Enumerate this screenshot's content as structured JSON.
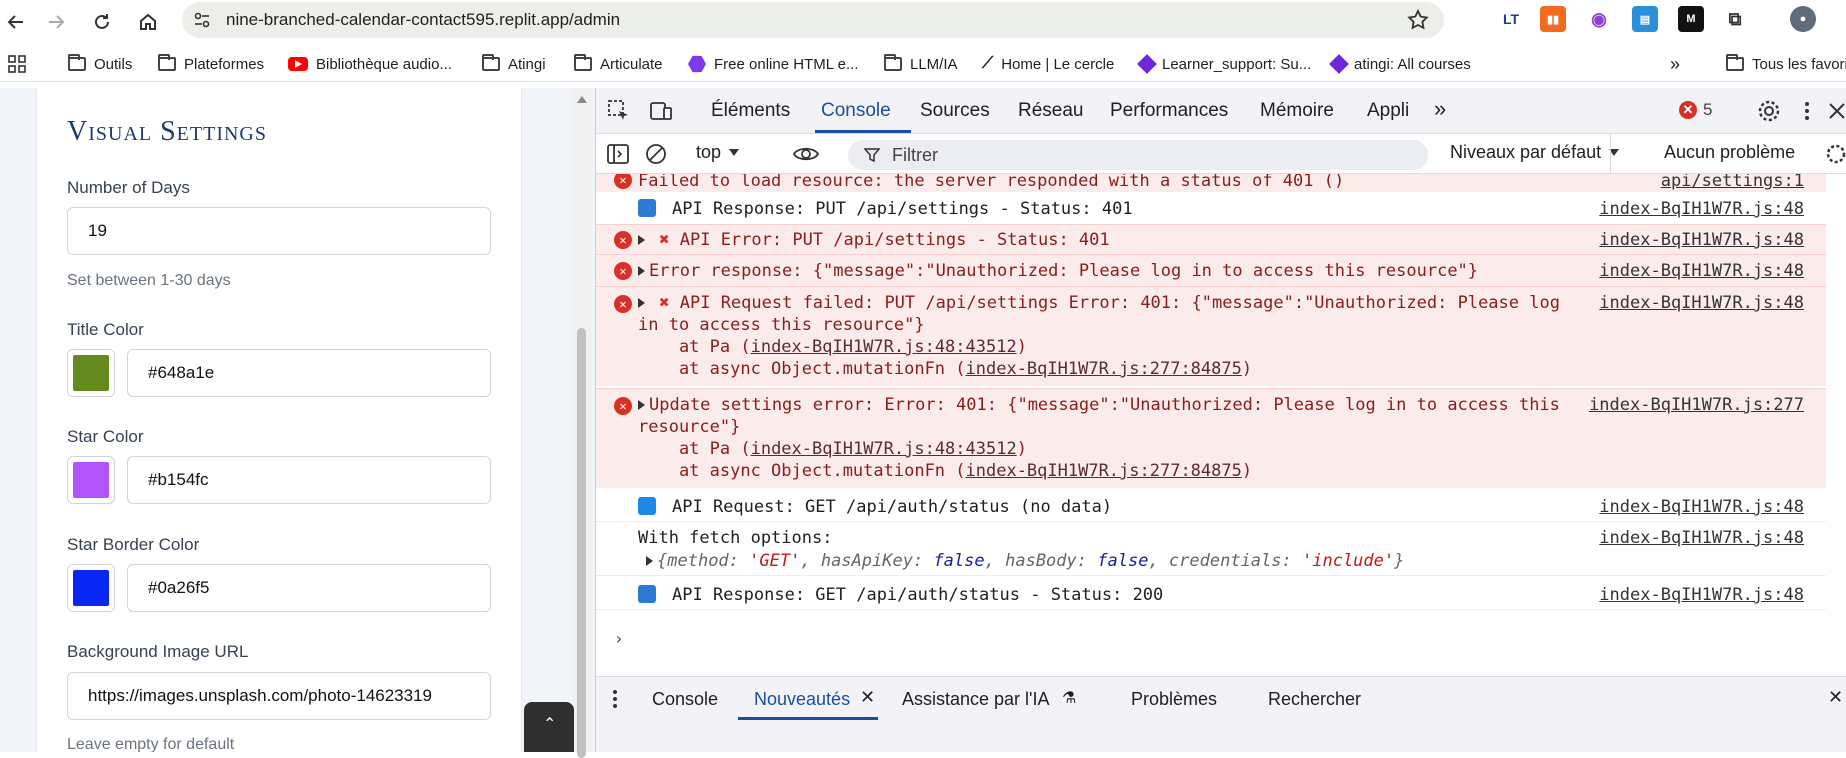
{
  "browser": {
    "url": "nine-branched-calendar-contact595.replit.app/admin",
    "bookmarks": [
      {
        "label": "Outils",
        "icon": "folder-icon"
      },
      {
        "label": "Plateformes",
        "icon": "folder-icon"
      },
      {
        "label": "Bibliothèque audio...",
        "icon": "youtube-icon"
      },
      {
        "label": "Atingi",
        "icon": "folder-icon"
      },
      {
        "label": "Articulate",
        "icon": "folder-icon"
      },
      {
        "label": "Free online HTML e...",
        "icon": "hexagon-icon"
      },
      {
        "label": "LLM/IA",
        "icon": "folder-icon"
      },
      {
        "label": "Home | Le cercle",
        "icon": "trend-icon"
      },
      {
        "label": "Learner_support: Su...",
        "icon": "diamond-icon"
      },
      {
        "label": "atingi: All courses",
        "icon": "diamond-icon"
      }
    ],
    "bookmarks_overflow": "»",
    "other_bookmarks": "Tous les favoris"
  },
  "settings": {
    "section_title": "Visual Settings",
    "number_of_days_label": "Number of Days",
    "number_of_days_value": "19",
    "number_of_days_help": "Set between 1-30 days",
    "title_color_label": "Title Color",
    "title_color_value": "#648a1e",
    "star_color_label": "Star Color",
    "star_color_value": "#b154fc",
    "star_border_color_label": "Star Border Color",
    "star_border_color_value": "#0a26f5",
    "bg_image_label": "Background Image URL",
    "bg_image_value": "https://images.unsplash.com/photo-14623319",
    "bg_image_help": "Leave empty for default"
  },
  "devtools": {
    "tabs": [
      "Éléments",
      "Console",
      "Sources",
      "Réseau",
      "Performances",
      "Mémoire",
      "Appli"
    ],
    "active_tab": "Console",
    "error_count": "5",
    "context": "top",
    "filter_placeholder": "Filtrer",
    "levels": "Niveaux par défaut",
    "issues": "Aucun problème",
    "messages": {
      "m0_text": "Failed to load resource: the server responded with a status of 401 ()",
      "m0_src": "api/settings:1",
      "m1_text": "API Response: PUT /api/settings - Status: 401",
      "m1_src": "index-BqIH1W7R.js:48",
      "m2_text": "API Error: PUT /api/settings - Status: 401",
      "m2_src": "index-BqIH1W7R.js:48",
      "m3_text": "Error response: {\"message\":\"Unauthorized: Please log in to access this resource\"}",
      "m3_src": "index-BqIH1W7R.js:48",
      "m4_line1": "API Request failed: PUT /api/settings Error: 401: {\"message\":\"Unauthorized: Please log",
      "m4_line2": "in to access this resource\"}",
      "m4_at1_prefix": "    at Pa (",
      "m4_at1_link": "index-BqIH1W7R.js:48:43512",
      "m4_at2_prefix": "    at async Object.mutationFn (",
      "m4_at2_link": "index-BqIH1W7R.js:277:84875",
      "m4_src": "index-BqIH1W7R.js:48",
      "m5_line1": "Update settings error: Error: 401: {\"message\":\"Unauthorized: Please log in to access this",
      "m5_line2": "resource\"}",
      "m5_at1_prefix": "    at Pa (",
      "m5_at1_link": "index-BqIH1W7R.js:48:43512",
      "m5_at2_prefix": "    at async Object.mutationFn (",
      "m5_at2_link": "index-BqIH1W7R.js:277:84875",
      "m5_src": "index-BqIH1W7R.js:277",
      "m6_text": "API Request: GET /api/auth/status (no data)",
      "m6_src": "index-BqIH1W7R.js:48",
      "m7_text": "With fetch options:",
      "m7_src": "index-BqIH1W7R.js:48",
      "m7_obj": {
        "k1": "method",
        "v1": "'GET'",
        "k2": "hasApiKey",
        "v2": "false",
        "k3": "hasBody",
        "v3": "false",
        "k4": "credentials",
        "v4": "'include'"
      },
      "m8_text": "API Response: GET /api/auth/status - Status: 200",
      "m8_src": "index-BqIH1W7R.js:48"
    },
    "drawer_tabs": [
      "Console",
      "Nouveautés",
      "Assistance par l'IA",
      "Problèmes",
      "Rechercher"
    ],
    "drawer_active": "Nouveautés"
  },
  "colors": {
    "title_color": "#648a1e",
    "star_color": "#b154fc",
    "star_border_color": "#0a26f5",
    "accent": "#1a4fa0",
    "error": "#d93025"
  }
}
